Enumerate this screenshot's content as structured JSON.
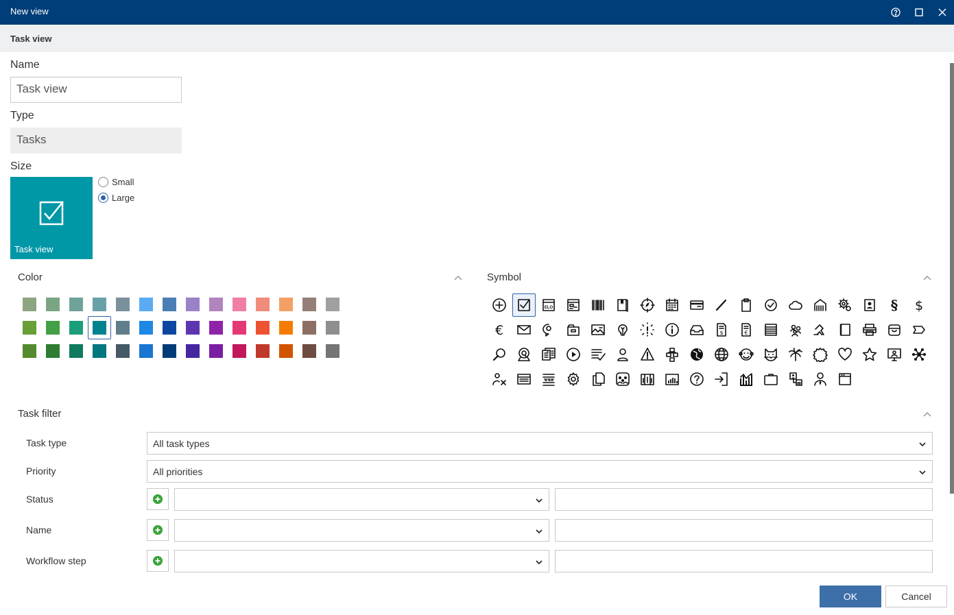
{
  "window": {
    "title": "New view"
  },
  "subheader": {
    "title": "Task view"
  },
  "form": {
    "name_label": "Name",
    "name_value": "Task view",
    "type_label": "Type",
    "type_value": "Tasks",
    "size_label": "Size",
    "size_options": [
      "Small",
      "Large"
    ],
    "size_selected": "Large",
    "tile_label": "Task view"
  },
  "color_section": {
    "title": "Color",
    "selected": "#00838f",
    "rows": [
      [
        "#8da581",
        "#7aa583",
        "#6fa39a",
        "#6aa1a8",
        "#7a919c",
        "#5aabf3",
        "#4a7fb5",
        "#9982c8",
        "#b284bf",
        "#ef7fa5",
        "#ef8c7c",
        "#f4a064",
        "#948078",
        "#a0a0a0"
      ],
      [
        "#689f38",
        "#43a047",
        "#1b9e7b",
        "#00838f",
        "#607d8b",
        "#1e88e5",
        "#0d47a1",
        "#5e35b1",
        "#8e24aa",
        "#e53975",
        "#ed5333",
        "#f57c00",
        "#8d6e63",
        "#8e8e8e"
      ],
      [
        "#558b2f",
        "#2e7d32",
        "#0f7a5f",
        "#00767e",
        "#455a64",
        "#1976d2",
        "#003c78",
        "#4527a0",
        "#7b1fa2",
        "#c2185b",
        "#c0392b",
        "#d35400",
        "#6d4c41",
        "#757575"
      ]
    ]
  },
  "symbol_section": {
    "title": "Symbol",
    "selected": "check-box",
    "rows": [
      [
        "plus-circle",
        "check-box",
        "elo-form",
        "form-layout",
        "barcode",
        "book",
        "compass",
        "calendar",
        "credit-card",
        "pencil",
        "clipboard",
        "check-circle",
        "cloud",
        "building",
        "gears",
        "contact-book",
        "paragraph",
        "dollar"
      ],
      [
        "euro",
        "envelope",
        "chat-bulb",
        "folder-box",
        "image",
        "lightbulb",
        "alert-burst",
        "info",
        "inbox",
        "invoice-dollar",
        "invoice-euro",
        "list-box",
        "people-group",
        "pointer-hand",
        "notebook",
        "printer",
        "archive-box",
        "tag"
      ],
      [
        "search",
        "location-search",
        "documents",
        "play",
        "checklist",
        "person",
        "warning",
        "org-chart",
        "globe-filled",
        "globe",
        "monkey",
        "cat",
        "palm",
        "seal",
        "heart",
        "star",
        "presentation",
        "network"
      ],
      [
        "person-x",
        "id-card",
        "toolbar-lines",
        "gear",
        "copy",
        "people-box",
        "columns",
        "bar-chart",
        "question",
        "sign-in",
        "chart-bars",
        "briefcase",
        "org-person",
        "person-tie",
        "window"
      ]
    ]
  },
  "task_filter": {
    "title": "Task filter",
    "task_type_label": "Task type",
    "task_type_value": "All task types",
    "priority_label": "Priority",
    "priority_value": "All priorities",
    "rows": [
      {
        "label": "Status",
        "select_value": "",
        "input_value": ""
      },
      {
        "label": "Name",
        "select_value": "",
        "input_value": ""
      },
      {
        "label": "Workflow step",
        "select_value": "",
        "input_value": ""
      }
    ]
  },
  "buttons": {
    "ok": "OK",
    "cancel": "Cancel"
  },
  "colors": {
    "titlebar": "#003e79",
    "accent": "#2f62a7",
    "tile": "#0097a7",
    "ok_button": "#3d6fa9",
    "add_icon": "#3aa33a"
  }
}
